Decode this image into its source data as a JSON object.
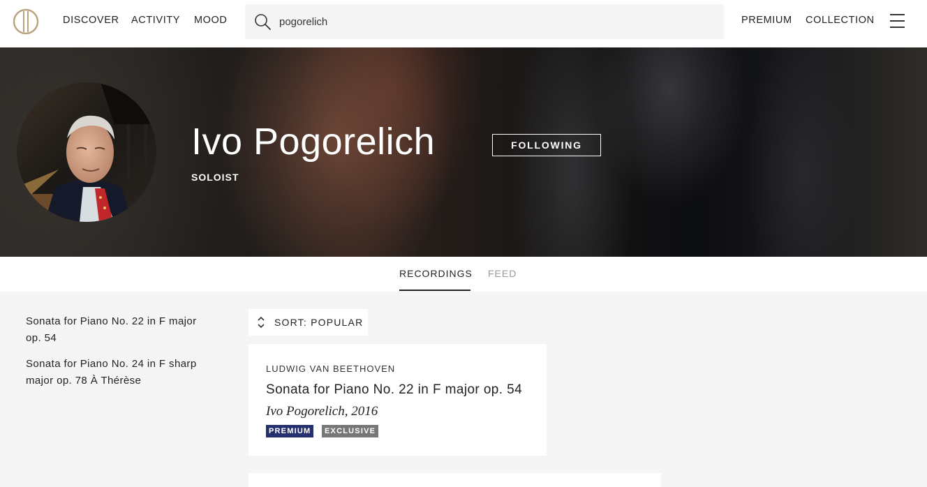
{
  "nav": {
    "items": [
      "DISCOVER",
      "ACTIVITY",
      "MOOD"
    ],
    "right_items": [
      "PREMIUM",
      "COLLECTION"
    ]
  },
  "search": {
    "value": "pogorelich"
  },
  "artist": {
    "name": "Ivo Pogorelich",
    "role": "SOLOIST",
    "follow_label": "FOLLOWING"
  },
  "tabs": {
    "recordings": "RECORDINGS",
    "feed": "FEED"
  },
  "sidebar": {
    "items": [
      "Sonata for Piano No. 22 in F major op. 54",
      "Sonata for Piano No. 24 in F sharp major op. 78 À Thérèse"
    ]
  },
  "sort": {
    "label": "SORT: POPULAR"
  },
  "recordings": [
    {
      "composer": "LUDWIG VAN BEETHOVEN",
      "title": "Sonata for Piano No. 22 in F major op. 54",
      "performer": "Ivo Pogorelich, 2016",
      "badges": [
        "PREMIUM",
        "EXCLUSIVE"
      ]
    }
  ],
  "colors": {
    "premium_badge": "#27306e",
    "exclusive_badge": "#777777",
    "logo": "#b9a27e"
  }
}
